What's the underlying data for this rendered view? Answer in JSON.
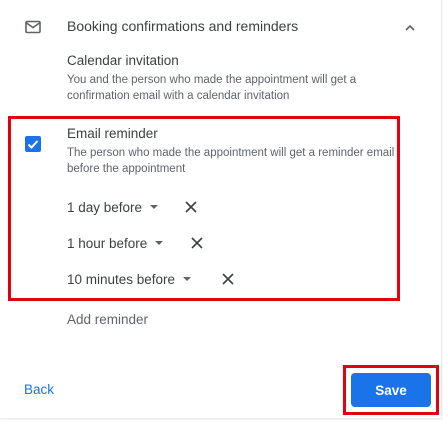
{
  "section": {
    "title": "Booking confirmations and reminders",
    "icon": "mail-icon",
    "collapse_icon": "chevron-up-icon"
  },
  "calendar_invitation": {
    "title": "Calendar invitation",
    "description": "You and the person who made the appointment will get a confirmation email with a calendar invitation"
  },
  "email_reminder": {
    "checked": true,
    "title": "Email reminder",
    "description": "The person who made the appointment will get a reminder email before the appointment",
    "reminders": [
      {
        "label": "1 day before"
      },
      {
        "label": "1 hour before"
      },
      {
        "label": "10 minutes before"
      }
    ],
    "add_label": "Add reminder"
  },
  "footer": {
    "back_label": "Back",
    "save_label": "Save"
  },
  "colors": {
    "accent": "#1a73e8",
    "highlight": "#e3000f"
  }
}
